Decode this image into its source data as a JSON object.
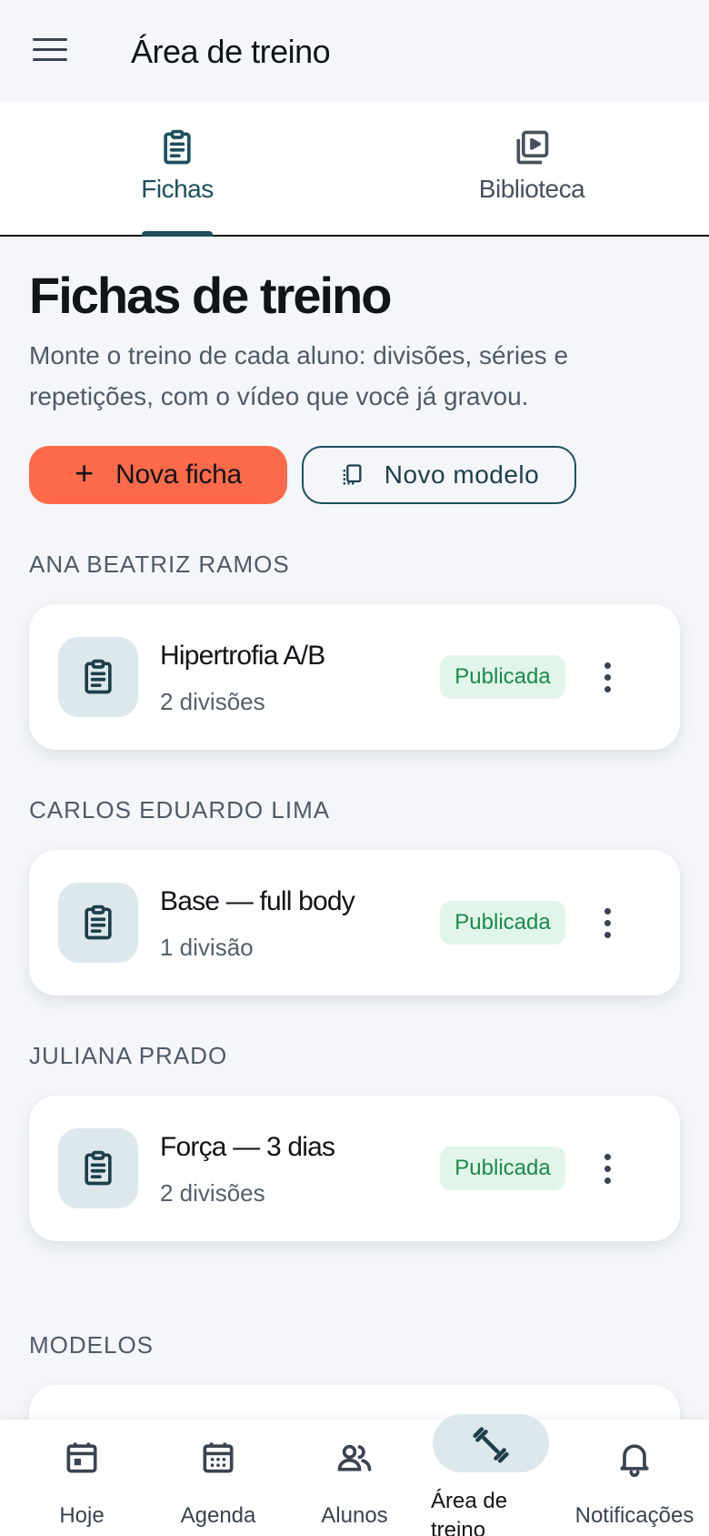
{
  "appbar": {
    "title": "Área de treino"
  },
  "tabs": [
    {
      "label": "Fichas",
      "icon": "clipboard-icon",
      "active": true
    },
    {
      "label": "Biblioteca",
      "icon": "video-library-icon",
      "active": false
    }
  ],
  "page": {
    "title": "Fichas de treino",
    "subtitle": "Monte o treino de cada aluno: divisões, séries e repetições, com o vídeo que você já gravou."
  },
  "actions": {
    "primary_label": "Nova ficha",
    "secondary_label": "Novo modelo"
  },
  "groups": [
    {
      "student": "ANA BEATRIZ RAMOS",
      "card": {
        "title": "Hipertrofia A/B",
        "subtitle": "2 divisões",
        "status": "Publicada"
      }
    },
    {
      "student": "CARLOS EDUARDO LIMA",
      "card": {
        "title": "Base — full body",
        "subtitle": "1 divisão",
        "status": "Publicada"
      }
    },
    {
      "student": "JULIANA PRADO",
      "card": {
        "title": "Força — 3 dias",
        "subtitle": "2 divisões",
        "status": "Publicada"
      }
    }
  ],
  "models_section": {
    "label": "MODELOS"
  },
  "bottom_nav": [
    {
      "label": "Hoje",
      "icon": "calendar-today-icon"
    },
    {
      "label": "Agenda",
      "icon": "calendar-icon"
    },
    {
      "label": "Alunos",
      "icon": "people-icon"
    },
    {
      "label": "Área de treino",
      "icon": "dumbbell-icon",
      "active": true
    },
    {
      "label": "Notificações",
      "icon": "bell-icon"
    }
  ],
  "colors": {
    "accent": "#ff6a4a",
    "primary": "#1e4f5c",
    "success_bg": "#e2f5ea",
    "success_text": "#1b8a4d",
    "background": "#f4f6f9"
  }
}
